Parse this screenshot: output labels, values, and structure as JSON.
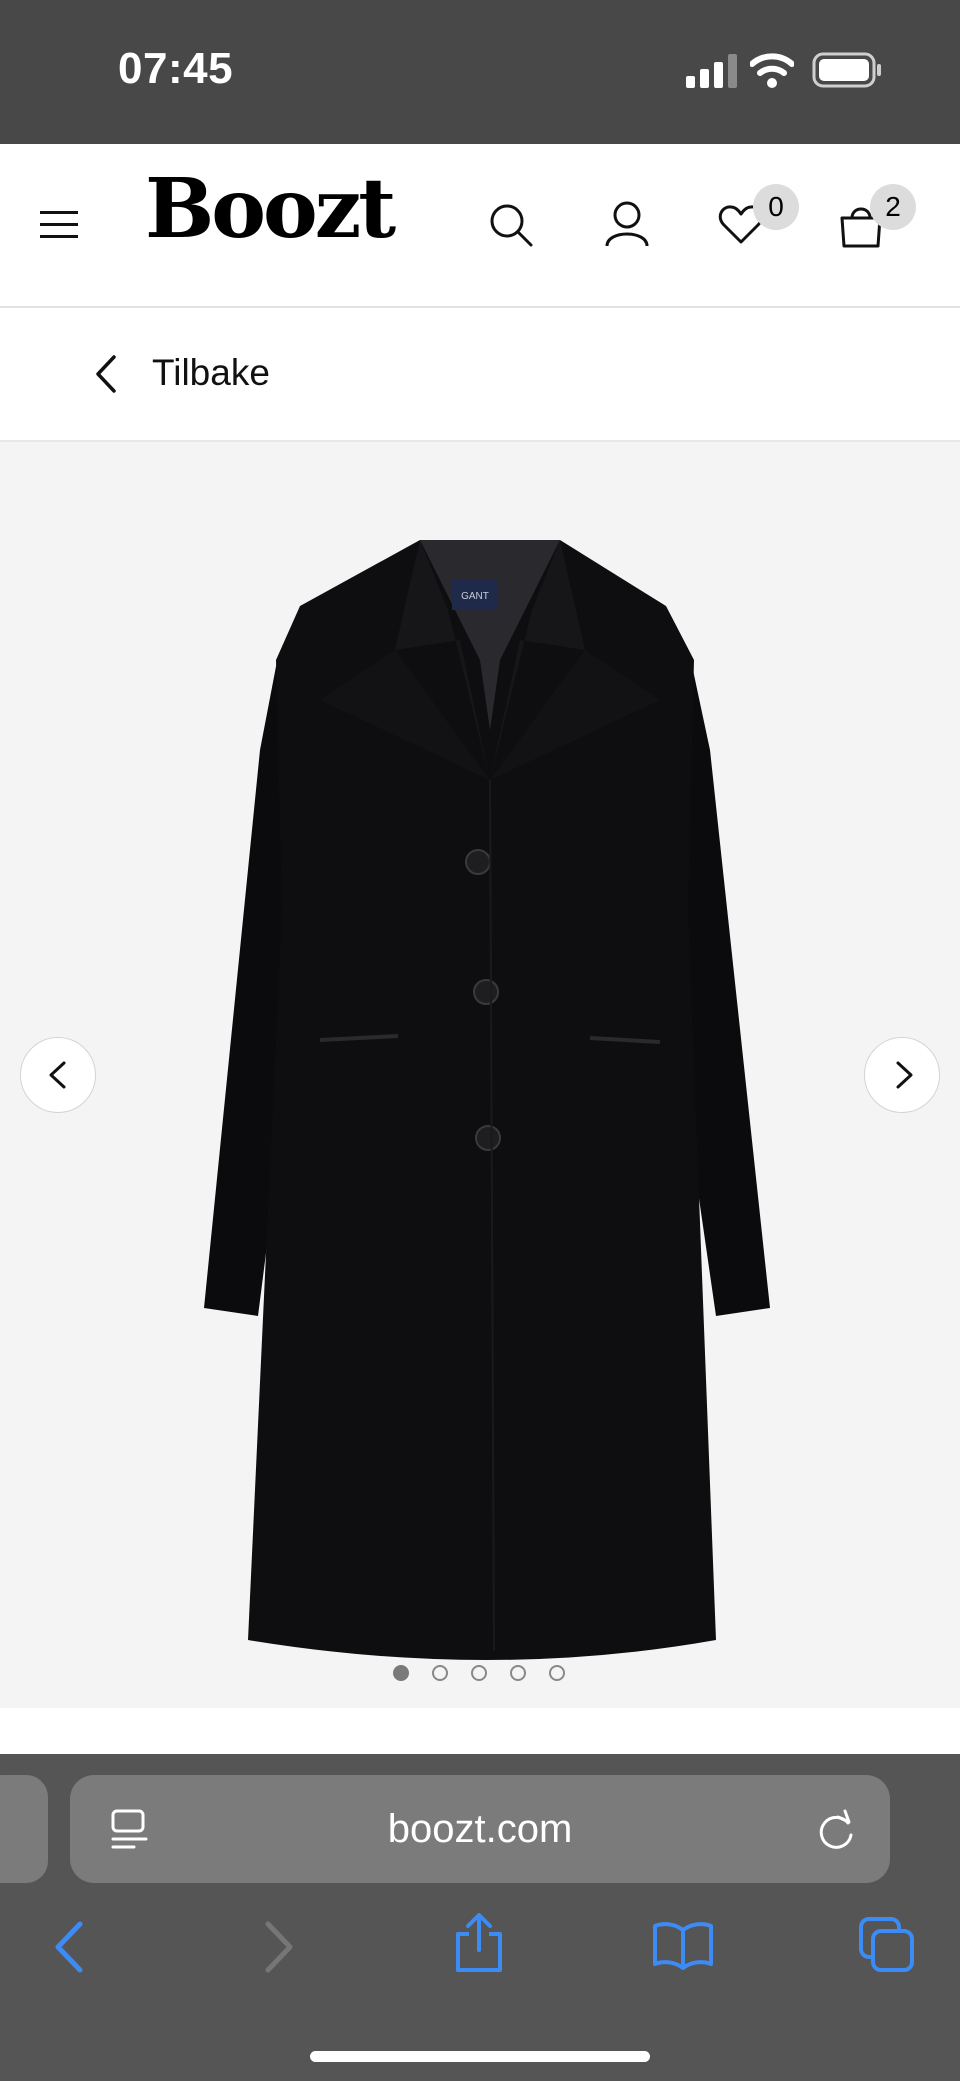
{
  "status_bar": {
    "time": "07:45"
  },
  "header": {
    "logo": "Boozt",
    "wishlist_count": "0",
    "cart_count": "2",
    "icons": [
      "menu-icon",
      "search-icon",
      "account-icon",
      "heart-icon",
      "bag-icon"
    ]
  },
  "back_nav": {
    "label": "Tilbake"
  },
  "gallery": {
    "product_label": "GANT",
    "image_count": 5,
    "active_index": 0
  },
  "browser": {
    "url": "boozt.com"
  },
  "colors": {
    "status_bar_bg": "#484848",
    "gallery_bg": "#f4f4f4",
    "safari_bar_bg": "#555555",
    "url_pill_bg": "#7b7b7b",
    "accent_blue": "#3d8bf5"
  }
}
